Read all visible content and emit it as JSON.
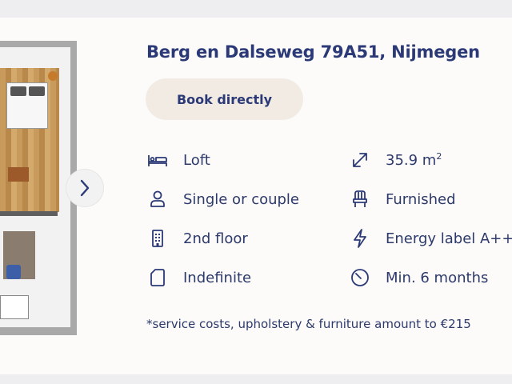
{
  "listing": {
    "title": "Berg en Dalseweg 79A51, Nijmegen",
    "book_label": "Book directly",
    "features": [
      {
        "icon": "bed-icon",
        "text": "Loft"
      },
      {
        "icon": "expand-icon",
        "text": "35.9 m",
        "sup": "2"
      },
      {
        "icon": "person-icon",
        "text": "Single or couple"
      },
      {
        "icon": "chair-icon",
        "text": "Furnished"
      },
      {
        "icon": "building-icon",
        "text": "2nd floor"
      },
      {
        "icon": "lightning-icon",
        "text": "Energy label A++"
      },
      {
        "icon": "document-icon",
        "text": "Indefinite"
      },
      {
        "icon": "clock-icon",
        "text": "Min. 6 months"
      }
    ],
    "note": "*service costs, upholstery & furniture amount to €215"
  },
  "gallery": {
    "image": "floor-plan-image",
    "next_icon": "chevron-right-icon"
  },
  "colors": {
    "accent": "#2b3a77",
    "button_bg": "#f1ebe4",
    "card_bg": "#fcfbfa"
  }
}
